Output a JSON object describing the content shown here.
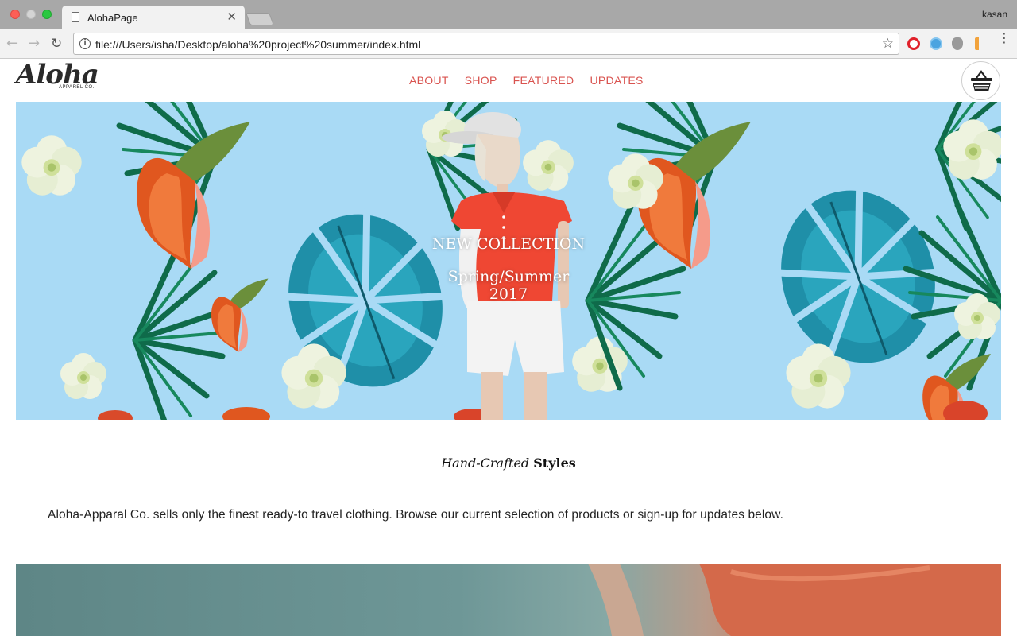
{
  "browser": {
    "tab_title": "AlohaPage",
    "tab_close": "✕",
    "profile_name": "kasan",
    "url": "file:///Users/isha/Desktop/aloha%20project%20summer/index.html",
    "icons": {
      "back": "←",
      "forward": "→",
      "reload": "↻",
      "info": "i",
      "star": "☆",
      "menu": "⋮"
    }
  },
  "site": {
    "logo": {
      "name": "Aloha",
      "tagline": "APPAREL CO."
    },
    "nav": [
      "ABOUT",
      "SHOP",
      "FEATURED",
      "UPDATES"
    ],
    "hero": {
      "headline": "NEW COLLECTION",
      "season_line1": "Spring/Summer",
      "season_line2": "2017"
    },
    "section": {
      "heading_italic": "Hand-Crafted",
      "heading_bold": "Styles",
      "intro": "Aloha-Apparal Co. sells only the finest ready-to travel clothing. Browse our current selection of products or sign-up for updates below."
    }
  },
  "colors": {
    "nav_link": "#d9534f",
    "hero_sky": "#a9daf5",
    "leaf_dark": "#0f6b4a",
    "leaf_teal": "#1f8fa8",
    "flower_orange": "#e0571f",
    "polo_red": "#ef4733"
  }
}
